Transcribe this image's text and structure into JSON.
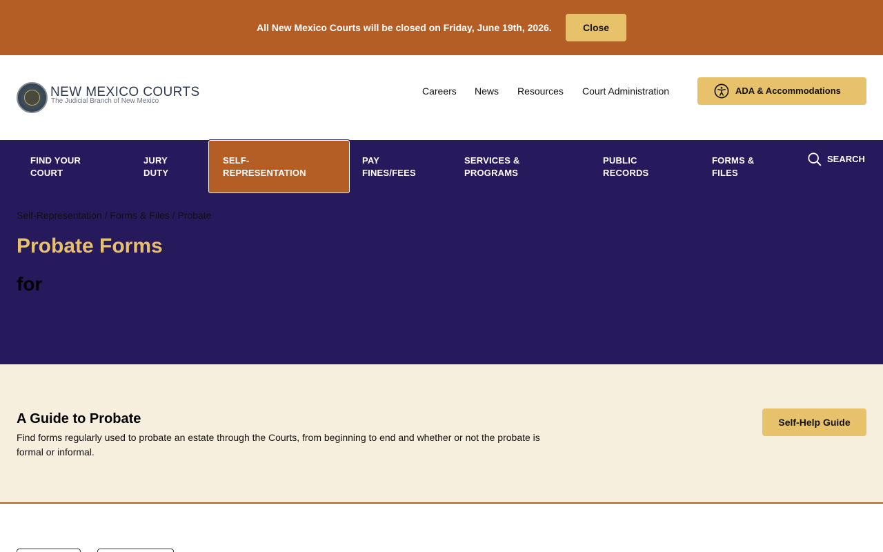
{
  "alert": {
    "message": "All New Mexico Courts will be closed on Friday, June 19th, 2026.",
    "close_label": "Close"
  },
  "header": {
    "logo_title": "NEW MEXICO COURTS",
    "logo_subtitle": "The Judicial Branch of New Mexico",
    "top_links": [
      "Careers",
      "News",
      "Resources",
      "Court Administration"
    ],
    "ada_label": "ADA & Accommodations",
    "ada_icon": "accessibility-icon"
  },
  "main_nav": {
    "items": [
      {
        "line1": "FIND YOUR",
        "line2": "COURT"
      },
      {
        "line1": "JURY",
        "line2": "DUTY"
      },
      {
        "line1": "SELF-",
        "line2": "REPRESENTATION",
        "active": true
      },
      {
        "line1": "PAY",
        "line2": "FINES/FEES"
      },
      {
        "line1": "SERVICES &",
        "line2": "PROGRAMS"
      },
      {
        "line1": "PUBLIC",
        "line2": "RECORDS"
      },
      {
        "line1": "FORMS &",
        "line2": "FILES"
      }
    ],
    "search_label": "SEARCH",
    "search_icon": "search-icon"
  },
  "hero": {
    "breadcrumb": [
      "Self-Representation",
      "Forms & Files",
      "Probate"
    ],
    "breadcrumb_sep": " / ",
    "title": "Probate Forms",
    "subtitle": "for"
  },
  "guide": {
    "title": "A Guide to Probate",
    "description": "Find forms regularly used to probate an estate through the Courts, from beginning to end and whether or not the probate is formal or informal.",
    "button_label": "Self-Help Guide"
  },
  "colors": {
    "brand_orange": "#b45e26",
    "brand_purple": "#26195c",
    "accent_gold": "#e8c26b",
    "cream": "#f7efdd"
  }
}
